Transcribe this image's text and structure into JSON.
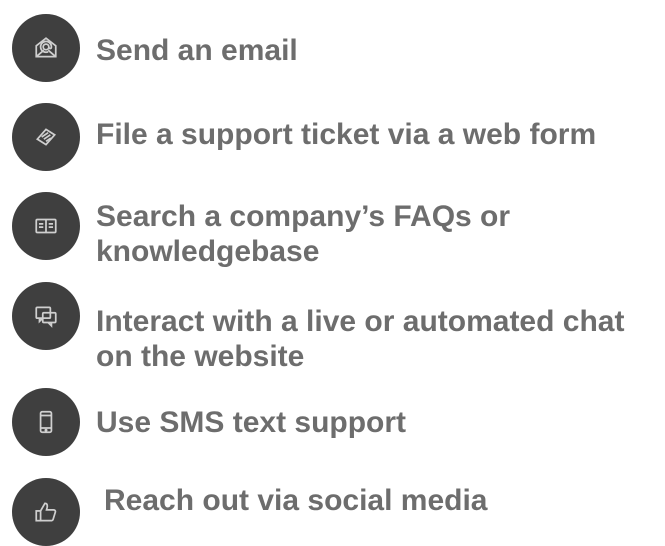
{
  "items": [
    {
      "icon": "email-icon",
      "label_lines": [
        "Send an email"
      ]
    },
    {
      "icon": "ticket-icon",
      "label_lines": [
        "File a support ticket via a web form"
      ]
    },
    {
      "icon": "knowledgebase-icon",
      "label_lines": [
        "Search a company’s FAQs or",
        "knowledgebase"
      ]
    },
    {
      "icon": "chat-icon",
      "label_lines": [
        "Interact with a live or automated chat",
        "on the website"
      ]
    },
    {
      "icon": "mobile-phone-icon",
      "label_lines": [
        "Use SMS text support"
      ]
    },
    {
      "icon": "thumbs-up-icon",
      "label_lines": [
        "Reach out via social media"
      ]
    }
  ],
  "colors": {
    "badge": "#3f3f3f",
    "icon": "#cfcfcf",
    "text": "#6d6d6d",
    "background": "#ffffff"
  }
}
